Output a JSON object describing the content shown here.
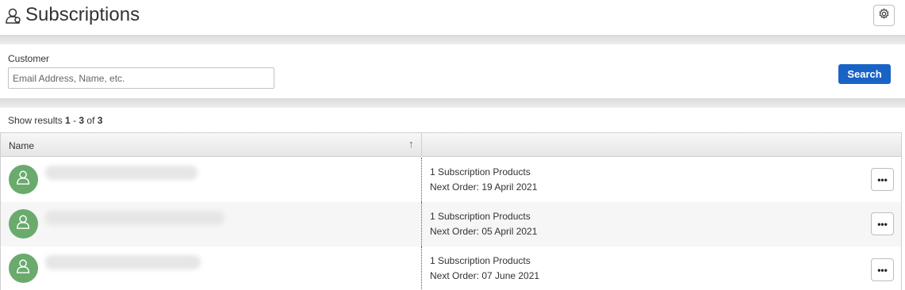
{
  "header": {
    "title": "Subscriptions",
    "title_icon": "user-icon",
    "settings_icon": "gear-icon"
  },
  "search": {
    "customer_label": "Customer",
    "customer_placeholder": "Email Address, Name, etc.",
    "customer_value": "",
    "search_label": "Search",
    "accent_color": "#1a63c6"
  },
  "results": {
    "prefix": "Show results",
    "from": "1",
    "sep": " - ",
    "to": "3",
    "of_word": " of ",
    "total": "3"
  },
  "grid": {
    "columns": [
      {
        "label": "Name",
        "sort": "ascending"
      },
      {
        "label": ""
      }
    ],
    "rows": [
      {
        "name": "",
        "products": "1 Subscription Products",
        "next_order": "Next Order:  19 April 2021",
        "actions": "•••"
      },
      {
        "name": "",
        "products": "1 Subscription Products",
        "next_order": "Next Order:  05 April 2021",
        "actions": "•••"
      },
      {
        "name": "",
        "products": "1 Subscription Products",
        "next_order": "Next Order:  07 June 2021",
        "actions": "•••"
      }
    ],
    "avatar_color": "#6aab6d"
  }
}
